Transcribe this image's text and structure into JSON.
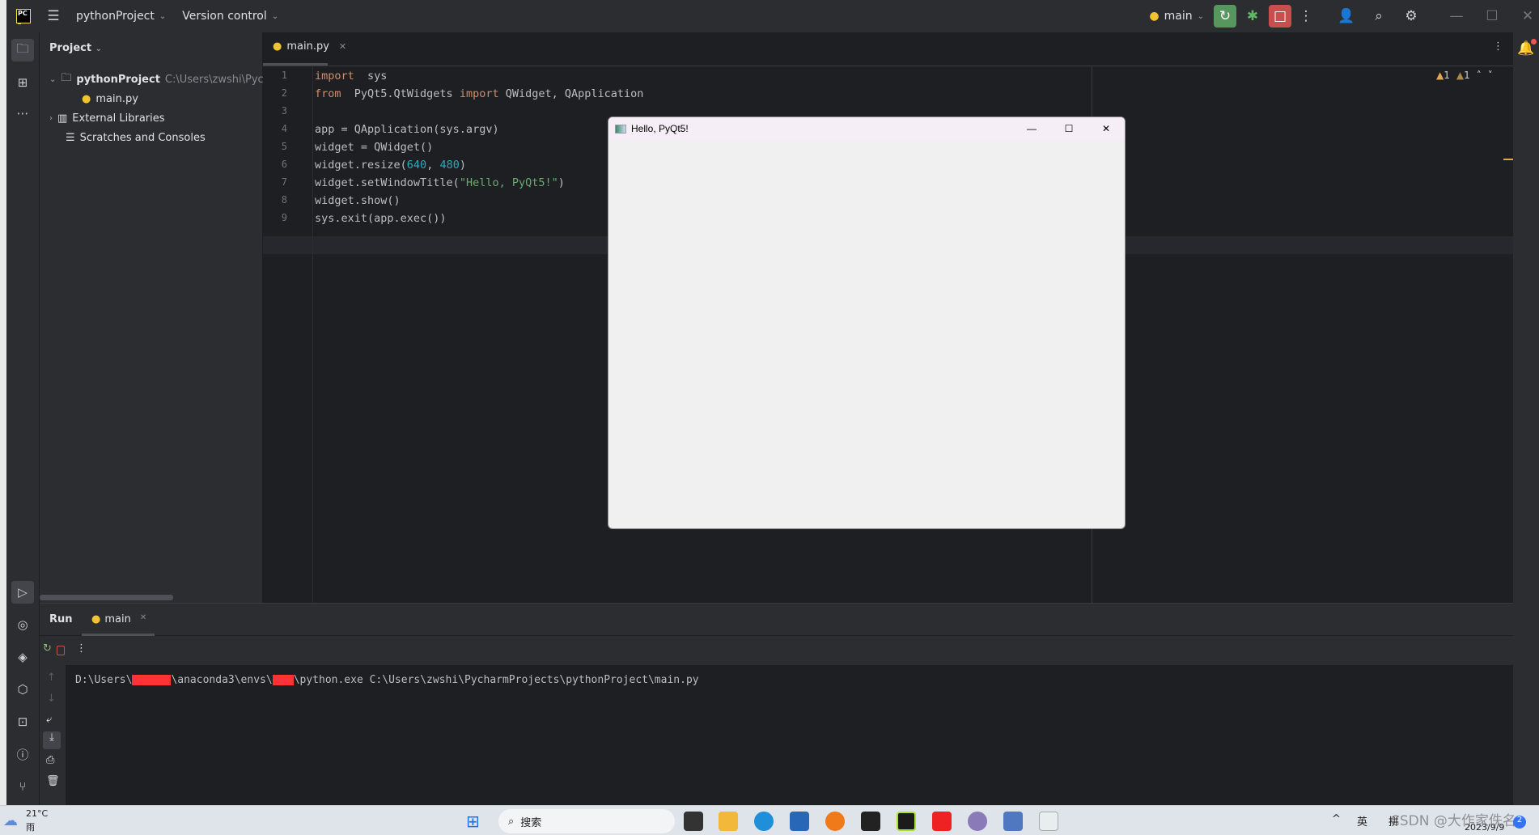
{
  "titlebar": {
    "project": "pythonProject",
    "vcs": "Version control",
    "run_config": "main"
  },
  "project_panel": {
    "title": "Project",
    "items": [
      {
        "label": "pythonProject",
        "path": "C:\\Users\\zwshi\\Pych",
        "icon": "folder-icon"
      },
      {
        "label": "main.py",
        "icon": "python-file-icon"
      },
      {
        "label": "External Libraries",
        "icon": "library-icon"
      },
      {
        "label": "Scratches and Consoles",
        "icon": "scratches-icon"
      }
    ]
  },
  "editor": {
    "tab": "main.py",
    "warnings": [
      "1",
      "1"
    ],
    "lines": [
      [
        [
          "kw",
          "import"
        ],
        [
          "",
          "  sys"
        ]
      ],
      [
        [
          "kw",
          "from"
        ],
        [
          "",
          "  PyQt5.QtWidgets "
        ],
        [
          "kw",
          "import"
        ],
        [
          "",
          "",
          " QWidget, QApplication"
        ]
      ],
      [],
      [
        [
          "",
          "app = QApplication(sys.argv)"
        ]
      ],
      [
        [
          "",
          "widget = QWidget()"
        ]
      ],
      [
        [
          "",
          "widget.resize("
        ],
        [
          "num",
          "640"
        ],
        [
          "",
          ", "
        ],
        [
          "num",
          "480"
        ],
        [
          "",
          ")"
        ]
      ],
      [
        [
          "",
          "widget.setWindowTitle("
        ],
        [
          "str",
          "\"Hello, PyQt5!\""
        ],
        [
          "",
          ")"
        ]
      ],
      [
        [
          "",
          "widget.show()"
        ]
      ],
      [
        [
          "",
          "sys.exit(app.exec())"
        ]
      ]
    ]
  },
  "hello_window": {
    "title": "Hello, PyQt5!"
  },
  "run_panel": {
    "title": "Run",
    "tab": "main",
    "output": [
      "D:\\Users\\",
      "\\anaconda3\\envs\\",
      "\\python.exe C:\\Users\\zwshi\\PycharmProjects\\pythonProject\\main.py"
    ],
    "redaction_color": "#ff3333"
  },
  "taskbar": {
    "temp": "21°C",
    "weather": "雨",
    "search": "搜索",
    "ime1": "英",
    "ime2": "拼",
    "date": "2023/9/9",
    "watermark": "CSDN @大作家佚名",
    "badge": "2"
  },
  "colors": {
    "run_green": "#57965c",
    "stop_red": "#c94f4f",
    "accent_blue": "#3574f0"
  }
}
